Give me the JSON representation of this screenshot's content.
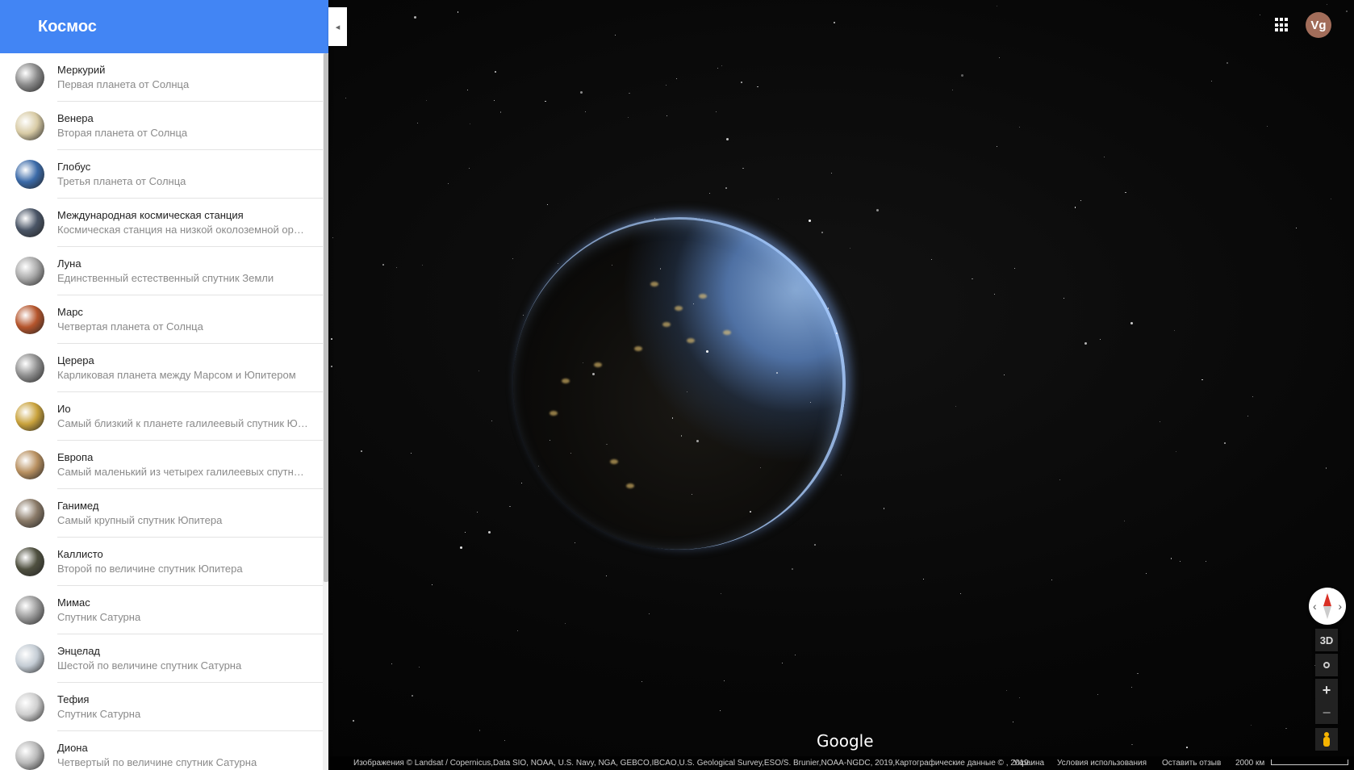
{
  "sidebar": {
    "title": "Космос",
    "collapse_icon": "◂",
    "items": [
      {
        "name": "Меркурий",
        "desc": "Первая планета от Солнца",
        "color": "#8a8a8a"
      },
      {
        "name": "Венера",
        "desc": "Вторая планета от Солнца",
        "color": "#d8cba5"
      },
      {
        "name": "Глобус",
        "desc": "Третья планета от Солнца",
        "color": "#3b6aa8"
      },
      {
        "name": "Международная космическая станция",
        "desc": "Космическая станция на низкой околоземной ор…",
        "color": "#4a5566"
      },
      {
        "name": "Луна",
        "desc": "Единственный естественный спутник Земли",
        "color": "#a8a8a8"
      },
      {
        "name": "Марс",
        "desc": "Четвертая планета от Солнца",
        "color": "#b5552c"
      },
      {
        "name": "Церера",
        "desc": "Карликовая планета между Марсом и Юпитером",
        "color": "#8f8f8f"
      },
      {
        "name": "Ио",
        "desc": "Самый близкий к планете галилеевый спутник Ю…",
        "color": "#c9a23c"
      },
      {
        "name": "Европа",
        "desc": "Самый маленький из четырех галилеевых спутн…",
        "color": "#b89060"
      },
      {
        "name": "Ганимед",
        "desc": "Самый крупный спутник Юпитера",
        "color": "#8a7a68"
      },
      {
        "name": "Каллисто",
        "desc": "Второй по величине спутник Юпитера",
        "color": "#4f5040"
      },
      {
        "name": "Мимас",
        "desc": "Спутник Сатурна",
        "color": "#9a9a9a"
      },
      {
        "name": "Энцелад",
        "desc": "Шестой по величине спутник Сатурна",
        "color": "#c4ccd4"
      },
      {
        "name": "Тефия",
        "desc": "Спутник Сатурна",
        "color": "#cfcfcf"
      },
      {
        "name": "Диона",
        "desc": "Четвертый по величине спутник Сатурна",
        "color": "#b9b9b9"
      }
    ]
  },
  "topbar": {
    "apps_icon": "apps-grid-icon",
    "avatar_initials": "Vg"
  },
  "controls": {
    "btn_3d": "3D",
    "zoom_in": "+",
    "zoom_out": "−"
  },
  "map": {
    "google_logo": "Google"
  },
  "footer": {
    "attribution": "Изображения © Landsat / Copernicus,Data SIO, NOAA, U.S. Navy, NGA, GEBCO,IBCAO,U.S. Geological Survey,ESO/S. Brunier,NOAA-NGDC, 2019,Картографические данные © , 2019",
    "country": "Украина",
    "terms": "Условия использования",
    "feedback": "Оставить отзыв",
    "scale": "2000 км"
  }
}
